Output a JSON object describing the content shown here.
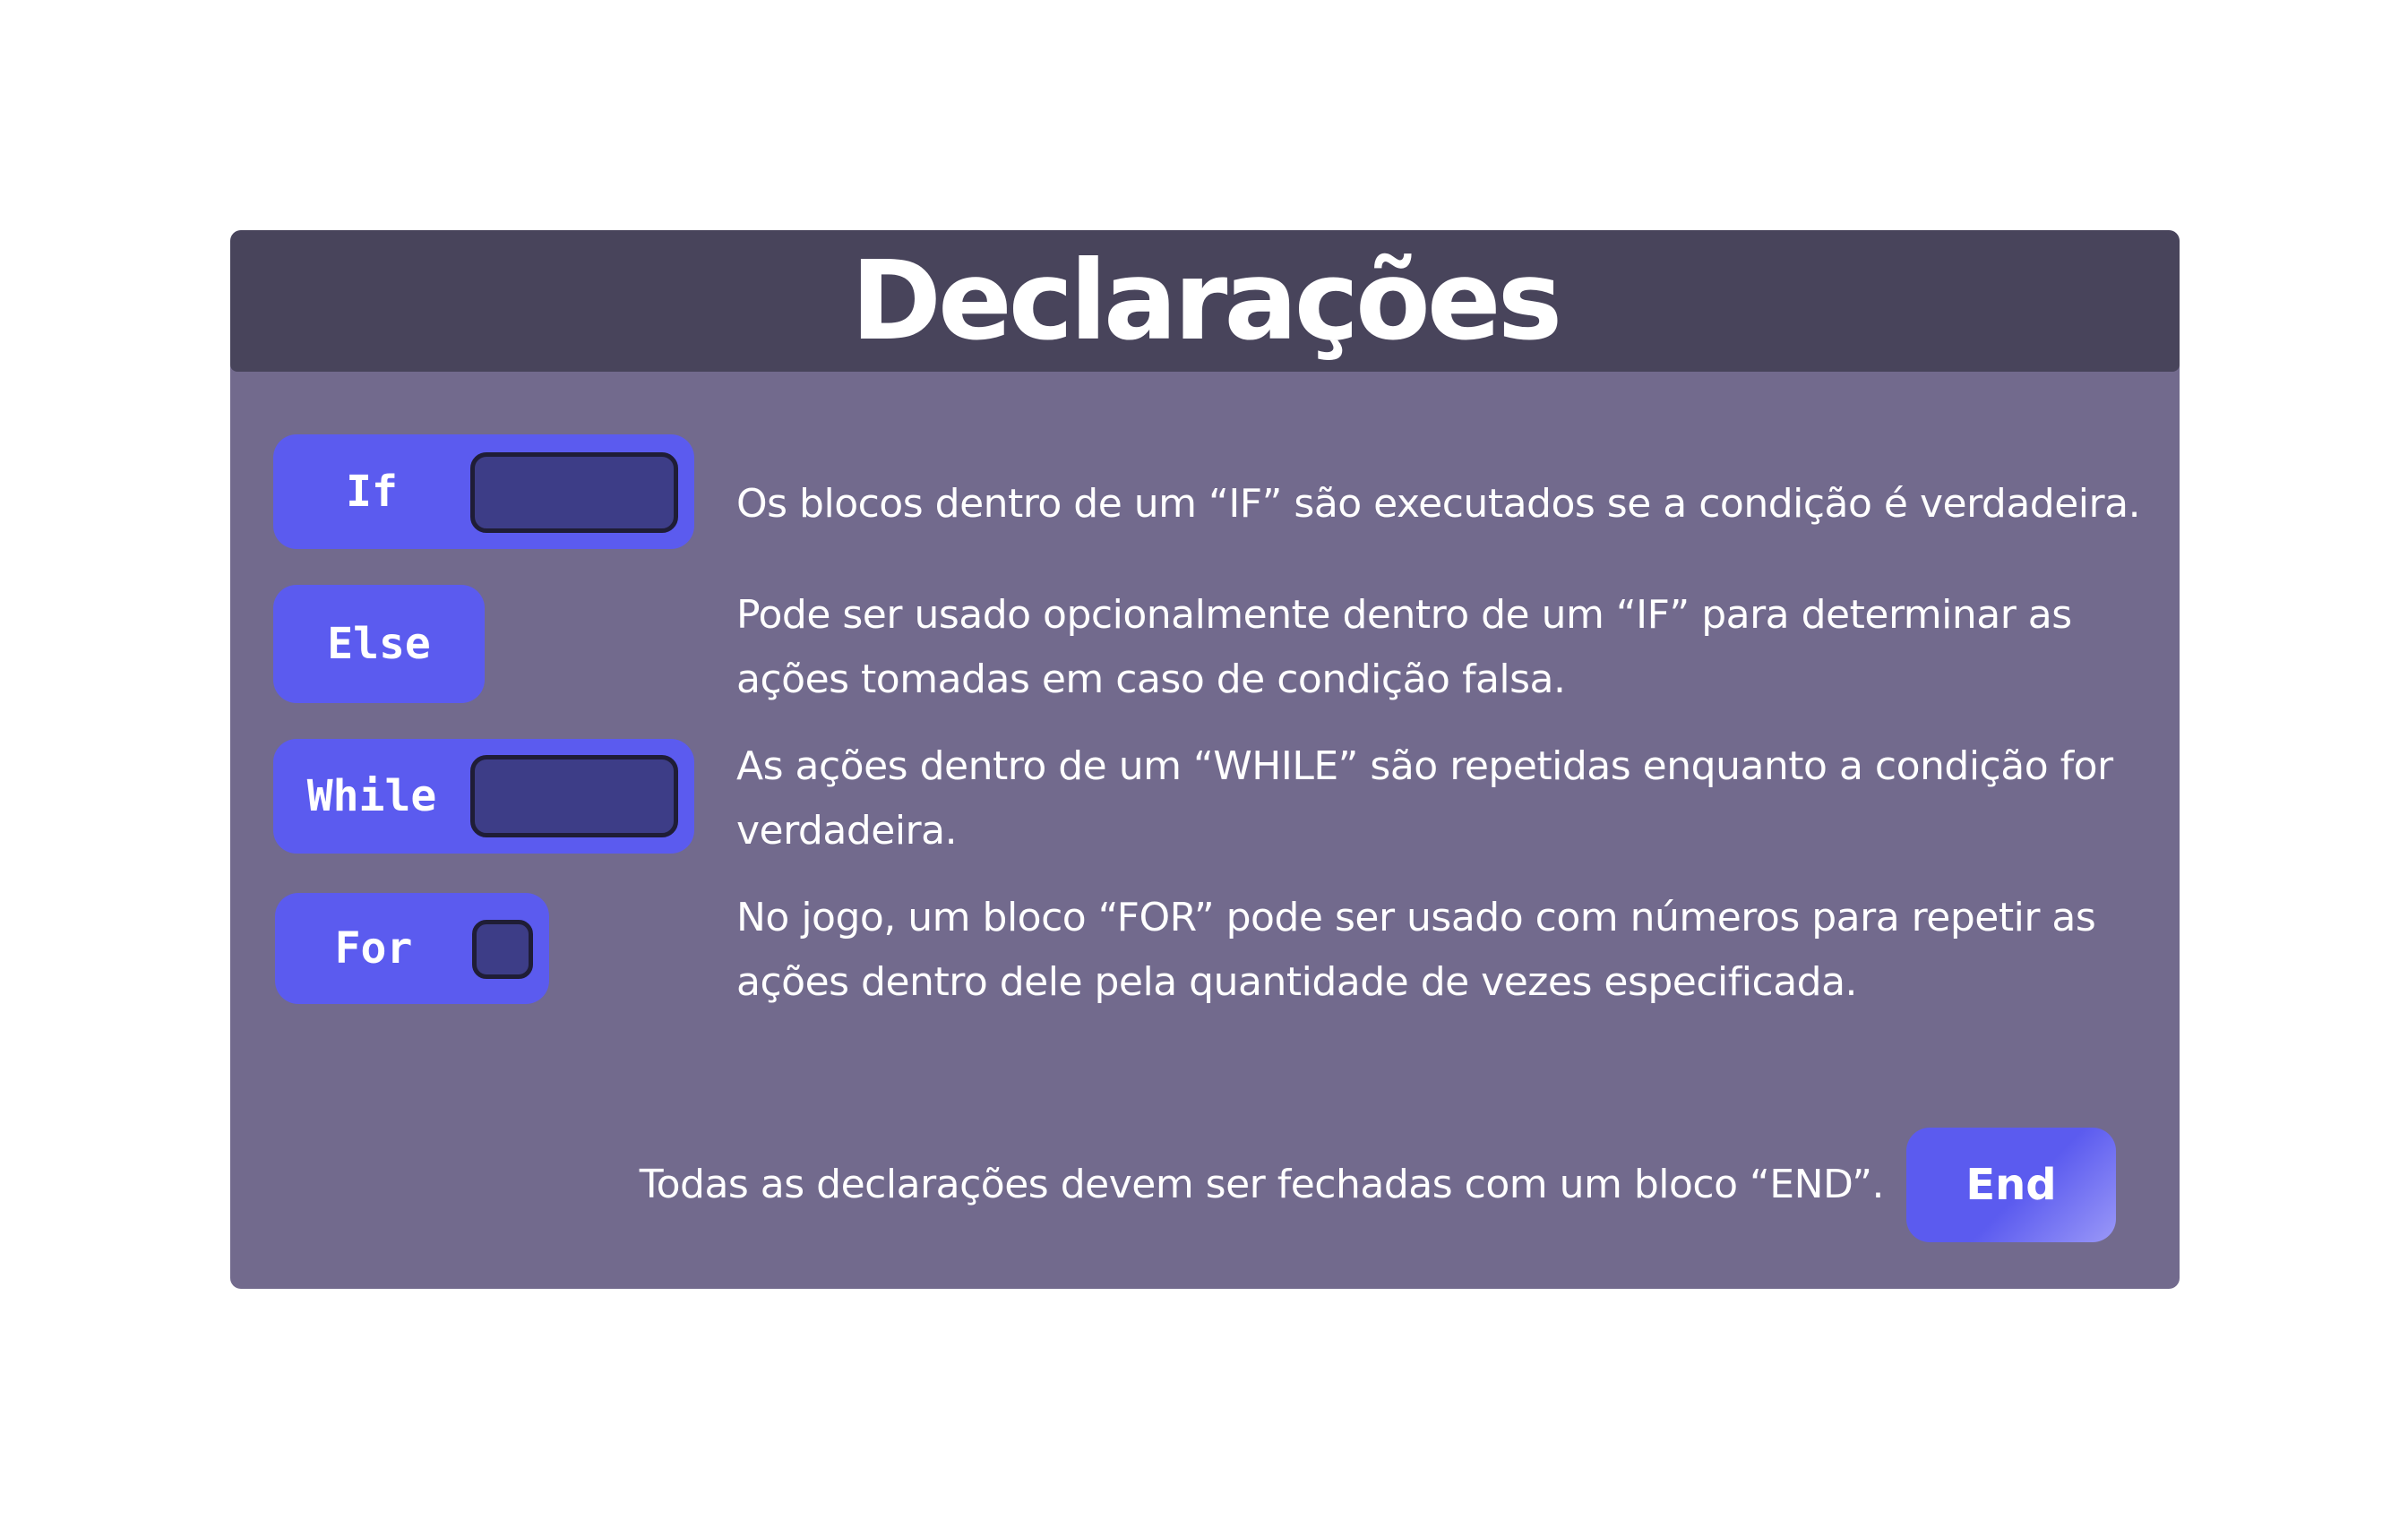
{
  "title": "Declarações",
  "statements": [
    {
      "block_label": "If",
      "description": "Os blocos dentro de um “IF” são executados se a condição é verdadeira."
    },
    {
      "block_label": "Else",
      "description": "Pode ser usado opcionalmente dentro de um “IF” para determinar as ações tomadas em caso de condição falsa."
    },
    {
      "block_label": "While",
      "description": "As ações dentro de um “WHILE” são repetidas enquanto a condição for verdadeira."
    },
    {
      "block_label": "For",
      "description": "No jogo, um bloco “FOR” pode ser usado com números para repetir as ações dentro dele pela quantidade de vezes especificada."
    }
  ],
  "footer": {
    "text": "Todas as declarações devem ser fechadas com um bloco “END”.",
    "end_block_label": "End"
  },
  "colors": {
    "header": "#48445b",
    "panel": "#726a8d",
    "block": "#5b5bef",
    "slot": "#3d3d87"
  }
}
